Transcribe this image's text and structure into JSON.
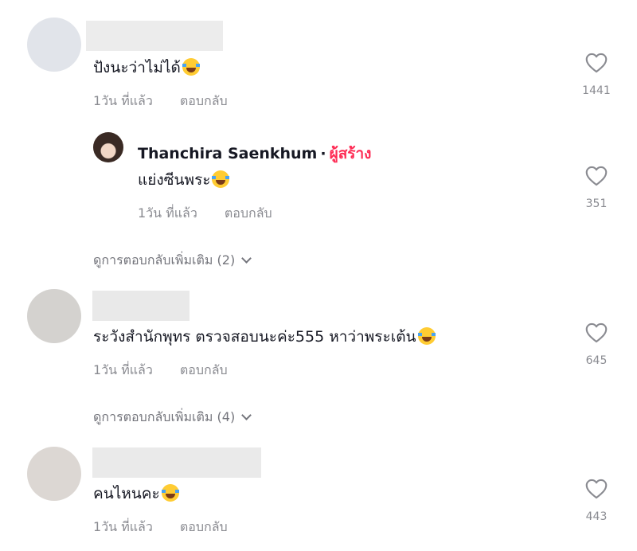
{
  "comments": [
    {
      "text": "ปังนะว่าไม่ได้",
      "time": "1วัน ที่แล้ว",
      "reply_label": "ตอบกลับ",
      "likes": "1441",
      "reply": {
        "author": "Thanchira Saenkhum",
        "separator": "·",
        "badge": "ผู้สร้าง",
        "text": "แย่งซีนพระ",
        "time": "1วัน ที่แล้ว",
        "reply_label": "ตอบกลับ",
        "likes": "351"
      },
      "view_more": "ดูการตอบกลับเพิ่มเติม (2)"
    },
    {
      "text": "ระวังสำนักพุทร ตรวจสอบนะค่ะ555 หาว่าพระเต้น",
      "time": "1วัน ที่แล้ว",
      "reply_label": "ตอบกลับ",
      "likes": "645",
      "view_more": "ดูการตอบกลับเพิ่มเติม (4)"
    },
    {
      "text": "คนไหนคะ",
      "time": "1วัน ที่แล้ว",
      "reply_label": "ตอบกลับ",
      "likes": "443"
    }
  ],
  "colors": {
    "accent": "#fe2c55",
    "muted": "#8a8b91",
    "text": "#161823"
  },
  "icons": {
    "like": "heart-outline-icon",
    "emoji": "laughing-tears-emoji",
    "expand": "chevron-down-icon"
  }
}
